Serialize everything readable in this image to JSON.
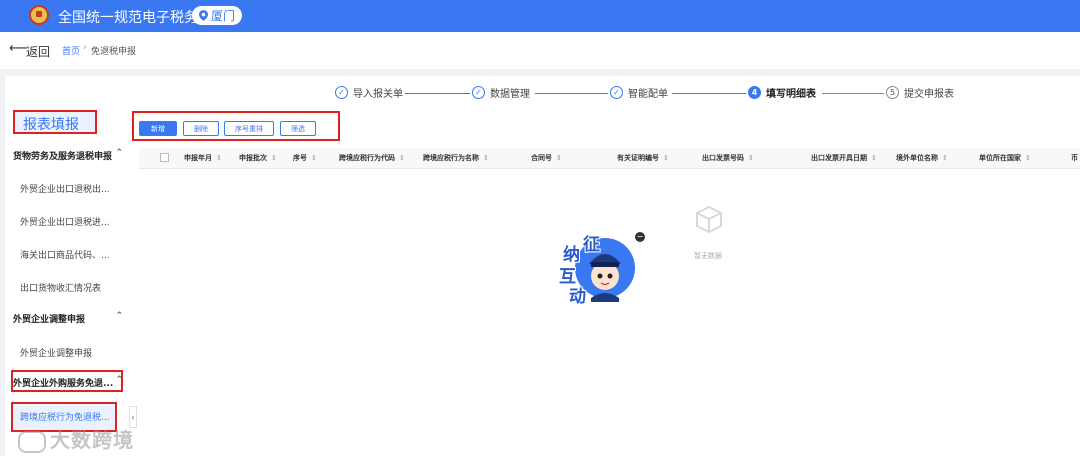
{
  "header": {
    "title": "全国统一规范电子税务局",
    "city": "厦门"
  },
  "nav": {
    "back_label": "返回",
    "breadcrumb_home": "首页",
    "breadcrumb_sep": "›",
    "breadcrumb_current": "免退税申报"
  },
  "steps": [
    {
      "label": "导入报关单",
      "mark": "✓"
    },
    {
      "label": "数据管理",
      "mark": "✓"
    },
    {
      "label": "智能配单",
      "mark": "✓"
    },
    {
      "label": "填写明细表",
      "mark": "4"
    },
    {
      "label": "提交申报表",
      "mark": "5"
    }
  ],
  "sidebar": {
    "title": "报表填报",
    "group1": "货物劳务及服务退税申报",
    "items1": [
      "外贸企业出口退税出...",
      "外贸企业出口退税进...",
      "海关出口商品代码、...",
      "出口货物收汇情况表"
    ],
    "group2": "外贸企业调整申报",
    "items2": [
      "外贸企业调整申报"
    ],
    "group3": "外贸企业外购服务免退...",
    "items3": [
      "跨境应税行为免退税..."
    ],
    "chevron": "⌃",
    "collapse": "‹"
  },
  "toolbar": {
    "add": "新增",
    "delete": "删除",
    "reorder": "序号重排",
    "filter": "筛选"
  },
  "table": {
    "sort_icon": "⇕",
    "columns": [
      "申报年月",
      "申报批次",
      "序号",
      "跨境应税行为代码",
      "跨境应税行为名称",
      "合同号",
      "有关证明编号",
      "出口发票号码",
      "出口发票开具日期",
      "境外单位名称",
      "单位所在国家",
      "币"
    ],
    "empty_text": "暂无数据"
  },
  "mascot": {
    "chars": [
      "征",
      "纳",
      "互",
      "动"
    ],
    "close": "−"
  },
  "watermark": "大数跨境",
  "colors": {
    "primary": "#3a78f2",
    "highlight": "#dd2222"
  }
}
